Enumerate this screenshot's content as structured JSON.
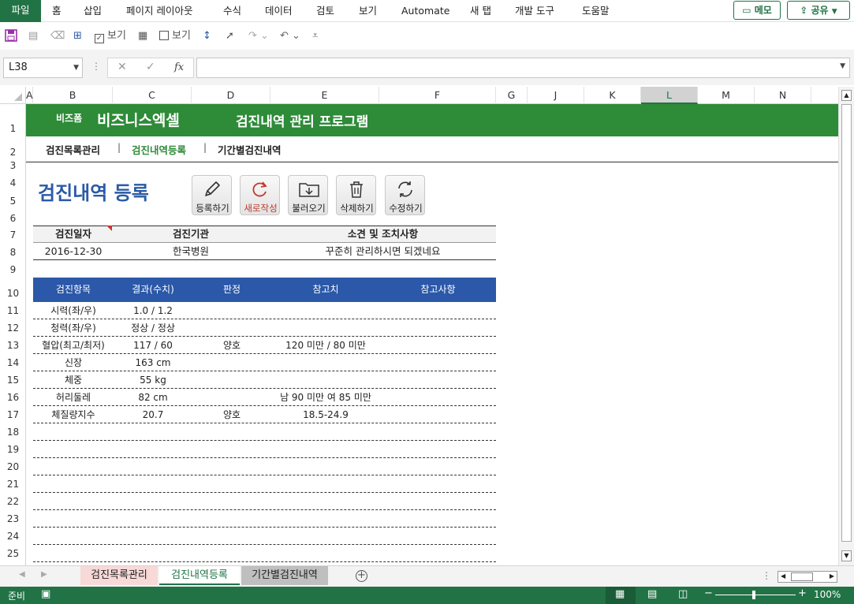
{
  "ribbon": {
    "tabs": [
      "파일",
      "홈",
      "삽입",
      "페이지 레이아웃",
      "수식",
      "데이터",
      "검토",
      "보기",
      "Automate",
      "새 탭",
      "개발 도구",
      "도움말"
    ],
    "memo": "메모",
    "share": "공유"
  },
  "qat": {
    "view1": "보기",
    "view2": "보기"
  },
  "formula_bar": {
    "name_box": "L38",
    "cancel": "✕",
    "enter": "✓",
    "fx": "fx",
    "formula": ""
  },
  "columns": [
    "A",
    "B",
    "C",
    "D",
    "E",
    "F",
    "G",
    "J",
    "K",
    "L",
    "M",
    "N"
  ],
  "selected_column": "L",
  "rows": [
    "1",
    "2",
    "3",
    "4",
    "5",
    "6",
    "7",
    "8",
    "9",
    "10",
    "11",
    "12",
    "13",
    "14",
    "15",
    "16",
    "17",
    "18",
    "19",
    "20",
    "21",
    "22",
    "23",
    "24",
    "25"
  ],
  "sheet": {
    "brand_small": "비즈폼",
    "brand_big": "비즈니스엑셀",
    "program_title": "검진내역 관리 프로그램",
    "nav": [
      "검진목록관리",
      "검진내역등록",
      "기간별검진내역"
    ],
    "nav_sep": "|",
    "page_heading": "검진내역 등록",
    "buttons": [
      "등록하기",
      "새로작성",
      "불러오기",
      "삭제하기",
      "수정하기"
    ],
    "info_headers": [
      "검진일자",
      "검진기관",
      "소견 및 조치사항"
    ],
    "info_values": [
      "2016-12-30",
      "한국병원",
      "꾸준히 관리하시면 되겠네요"
    ],
    "item_headers": [
      "검진항목",
      "결과(수치)",
      "판정",
      "참고치",
      "참고사항"
    ],
    "items": [
      [
        "시력(좌/우)",
        "1.0 / 1.2",
        "",
        "",
        ""
      ],
      [
        "청력(좌/우)",
        "정상 / 정상",
        "",
        "",
        ""
      ],
      [
        "혈압(최고/최저)",
        "117 / 60",
        "양호",
        "120 미만 / 80 미만",
        ""
      ],
      [
        "신장",
        "163 cm",
        "",
        "",
        ""
      ],
      [
        "체중",
        "55 kg",
        "",
        "",
        ""
      ],
      [
        "허리둘레",
        "82 cm",
        "",
        "남 90 미만 여 85 미만",
        ""
      ],
      [
        "체질량지수",
        "20.7",
        "양호",
        "18.5-24.9",
        ""
      ],
      [
        "",
        "",
        "",
        "",
        ""
      ],
      [
        "",
        "",
        "",
        "",
        ""
      ],
      [
        "",
        "",
        "",
        "",
        ""
      ],
      [
        "",
        "",
        "",
        "",
        ""
      ],
      [
        "",
        "",
        "",
        "",
        ""
      ],
      [
        "",
        "",
        "",
        "",
        ""
      ],
      [
        "",
        "",
        "",
        "",
        ""
      ],
      [
        "",
        "",
        "",
        "",
        ""
      ]
    ]
  },
  "sheet_tabs": [
    "검진목록관리",
    "검진내역등록",
    "기간별검진내역"
  ],
  "active_sheet_tab": "검진내역등록",
  "status": {
    "ready": "준비",
    "zoom": "100%",
    "minus": "−",
    "plus": "+"
  },
  "colors": {
    "excel_green": "#217346",
    "title_green": "#2e8b38",
    "header_blue": "#2b58a8",
    "heading_blue": "#2a5aa5"
  }
}
